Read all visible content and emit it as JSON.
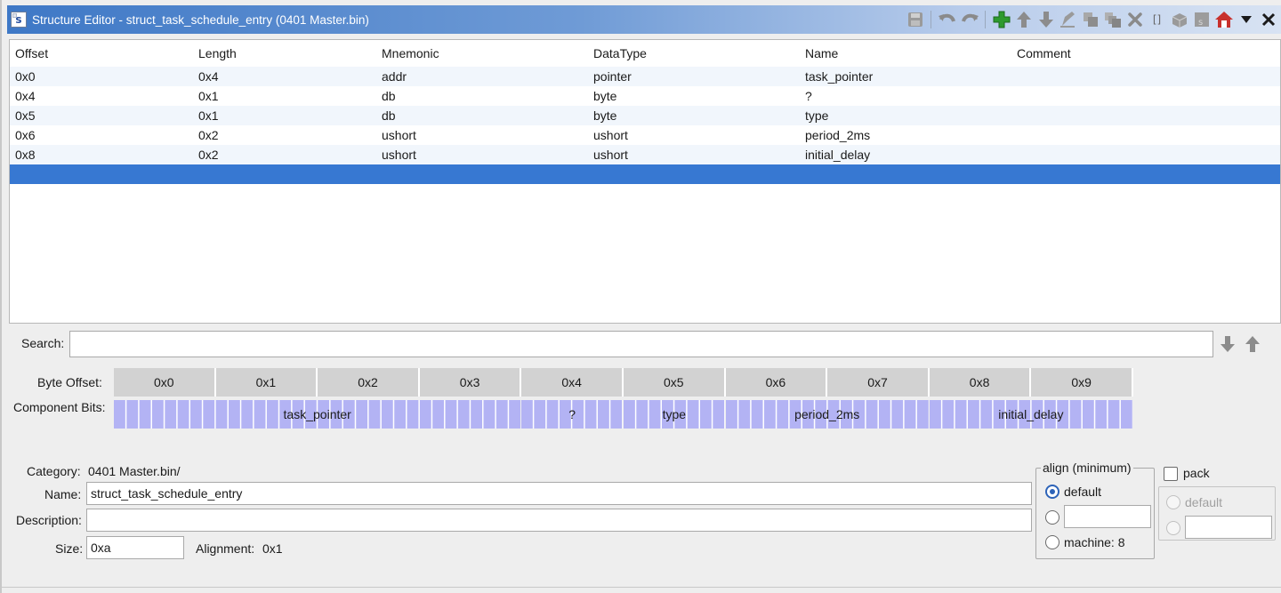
{
  "window": {
    "title": "Structure Editor - struct_task_schedule_entry (0401 Master.bin)",
    "app_icon_letter": "s"
  },
  "toolbar": {
    "icons": [
      "save-icon",
      "undo-icon",
      "redo-icon",
      "add-icon",
      "move-up-icon",
      "move-down-icon",
      "edit-icon",
      "duplicate-icon",
      "duplicate-multiple-icon",
      "delete-icon",
      "array-icon",
      "unpackage-icon",
      "structure-icon",
      "home-icon",
      "dropdown-menu-icon",
      "close-icon"
    ],
    "array_glyph": "[]"
  },
  "table": {
    "columns": [
      "Offset",
      "Length",
      "Mnemonic",
      "DataType",
      "Name",
      "Comment"
    ],
    "rows": [
      {
        "offset": "0x0",
        "length": "0x4",
        "mnemonic": "addr",
        "datatype": "pointer",
        "name": "task_pointer",
        "comment": ""
      },
      {
        "offset": "0x4",
        "length": "0x1",
        "mnemonic": "db",
        "datatype": "byte",
        "name": "?",
        "comment": ""
      },
      {
        "offset": "0x5",
        "length": "0x1",
        "mnemonic": "db",
        "datatype": "byte",
        "name": "type",
        "comment": ""
      },
      {
        "offset": "0x6",
        "length": "0x2",
        "mnemonic": "ushort",
        "datatype": "ushort",
        "name": "period_2ms",
        "comment": ""
      },
      {
        "offset": "0x8",
        "length": "0x2",
        "mnemonic": "ushort",
        "datatype": "ushort",
        "name": "initial_delay",
        "comment": ""
      }
    ]
  },
  "search": {
    "label": "Search:",
    "value": ""
  },
  "byte_grid": {
    "byte_offset_label": "Byte Offset:",
    "component_bits_label": "Component Bits:",
    "offsets": [
      "0x0",
      "0x1",
      "0x2",
      "0x3",
      "0x4",
      "0x5",
      "0x6",
      "0x7",
      "0x8",
      "0x9"
    ],
    "components": [
      {
        "name": "task_pointer",
        "bytes": 4
      },
      {
        "name": "?",
        "bytes": 1
      },
      {
        "name": "type",
        "bytes": 1
      },
      {
        "name": "period_2ms",
        "bytes": 2
      },
      {
        "name": "initial_delay",
        "bytes": 2
      }
    ]
  },
  "properties": {
    "category_label": "Category:",
    "category_value": "0401 Master.bin/",
    "name_label": "Name:",
    "name_value": "struct_task_schedule_entry",
    "description_label": "Description:",
    "description_value": "",
    "size_label": "Size:",
    "size_value": "0xa",
    "alignment_label": "Alignment:",
    "alignment_value": "0x1"
  },
  "align": {
    "legend": "align (minimum)",
    "default_label": "default",
    "custom_value": "",
    "machine_label": "machine: 8",
    "selected": "default"
  },
  "pack": {
    "label": "pack",
    "checked": false,
    "default_label": "default",
    "custom_value": ""
  },
  "colors": {
    "title_gradient_start": "#3e78c6",
    "selection": "#3778d2",
    "row_alt": "#f1f6fc",
    "byte_cell": "#d2d2d2",
    "component_bits": "#b3b3f4",
    "radio_accent": "#2d63b8"
  }
}
